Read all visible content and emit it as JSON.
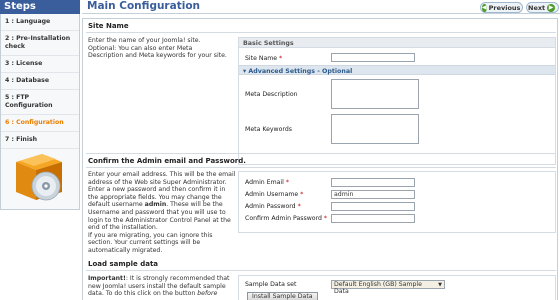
{
  "sidebar": {
    "title": "Steps",
    "items": [
      {
        "label": "1 : Language"
      },
      {
        "label": "2 : Pre-Installation check"
      },
      {
        "label": "3 : License"
      },
      {
        "label": "4 : Database"
      },
      {
        "label": "5 : FTP Configuration"
      },
      {
        "label": "6 : Configuration",
        "active": true
      },
      {
        "label": "7 : Finish"
      }
    ]
  },
  "header": {
    "title": "Main Configuration",
    "previous_label": "Previous",
    "next_label": "Next"
  },
  "site": {
    "heading": "Site Name",
    "description": "Enter the name of your Joomla! site. Optional: You can also enter Meta Description and Meta keywords for your site.",
    "panel_title": "Basic Settings",
    "site_name_label": "Site Name",
    "required_mark": "*",
    "advanced_label": "Advanced Settings - Optional",
    "meta_description_label": "Meta Description",
    "meta_keywords_label": "Meta Keywords"
  },
  "admin": {
    "heading": "Confirm the Admin email and Password.",
    "description_1": "Enter your email address. This will be the email address of the Web site Super Administrator.",
    "description_2_pre": "Enter a new password and then confirm it in the appropriate fields. You may change the default username ",
    "description_2_bold": "admin",
    "description_2_post": ". These will be the Username and password that you will use to login to the Administrator Control Panel at the end of the installation.",
    "description_3": "If you are migrating, you can ignore this section. Your current settings will be automatically migrated.",
    "email_label": "Admin Email",
    "username_label": "Admin Username",
    "username_value": "admin",
    "password_label": "Admin Password",
    "confirm_label": "Confirm Admin Password",
    "required_mark": "*"
  },
  "sample": {
    "heading": "Load sample data",
    "important_label": "Important!",
    "description_pre": ": It is strongly recommended that new Joomla! users install the default sample data. To do this click on the button ",
    "description_italic": "before",
    "set_label": "Sample Data set",
    "set_value": "Default English (GB) Sample Data",
    "install_button": "Install Sample Data"
  },
  "colors": {
    "accent": "#3a5e9b",
    "active_step": "#ea7f00",
    "nav_icon": "#4c9a2a"
  },
  "icons": {
    "previous": "arrow-left-icon",
    "next": "arrow-right-icon",
    "advanced_toggle": "chevron-down-icon",
    "select": "dropdown-arrow-icon",
    "box": "software-box-icon"
  }
}
